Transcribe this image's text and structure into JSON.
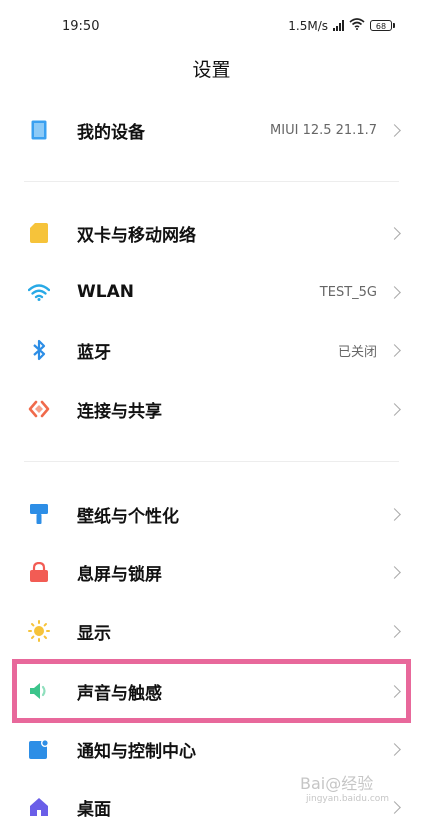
{
  "status_bar": {
    "time": "19:50",
    "speed": "1.5M/s",
    "battery": "68"
  },
  "title": "设置",
  "items": [
    {
      "label": "我的设备",
      "value": "MIUI 12.5 21.1.7",
      "icon": "phone-icon",
      "color": "#3aa0f0"
    },
    {
      "label": "双卡与移动网络",
      "value": "",
      "icon": "sim-card-icon",
      "color": "#f6c33a"
    },
    {
      "label": "WLAN",
      "value": "TEST_5G",
      "icon": "wifi-icon",
      "color": "#28a9e6"
    },
    {
      "label": "蓝牙",
      "value": "已关闭",
      "icon": "bluetooth-icon",
      "color": "#2d8ee6"
    },
    {
      "label": "连接与共享",
      "value": "",
      "icon": "share-icon",
      "color": "#f06a4b"
    },
    {
      "label": "壁纸与个性化",
      "value": "",
      "icon": "brush-icon",
      "color": "#2d8ee6"
    },
    {
      "label": "息屏与锁屏",
      "value": "",
      "icon": "lock-icon",
      "color": "#f25c54"
    },
    {
      "label": "显示",
      "value": "",
      "icon": "sun-icon",
      "color": "#f6c33a"
    },
    {
      "label": "声音与触感",
      "value": "",
      "icon": "speaker-icon",
      "color": "#3cc48b"
    },
    {
      "label": "通知与控制中心",
      "value": "",
      "icon": "notification-icon",
      "color": "#2d8ee6"
    },
    {
      "label": "桌面",
      "value": "",
      "icon": "home-icon",
      "color": "#6a5ee8"
    }
  ],
  "highlight_color": "#e8689b",
  "watermark": {
    "text": "Bai@经验",
    "sub": "jingyan.baidu.com"
  }
}
